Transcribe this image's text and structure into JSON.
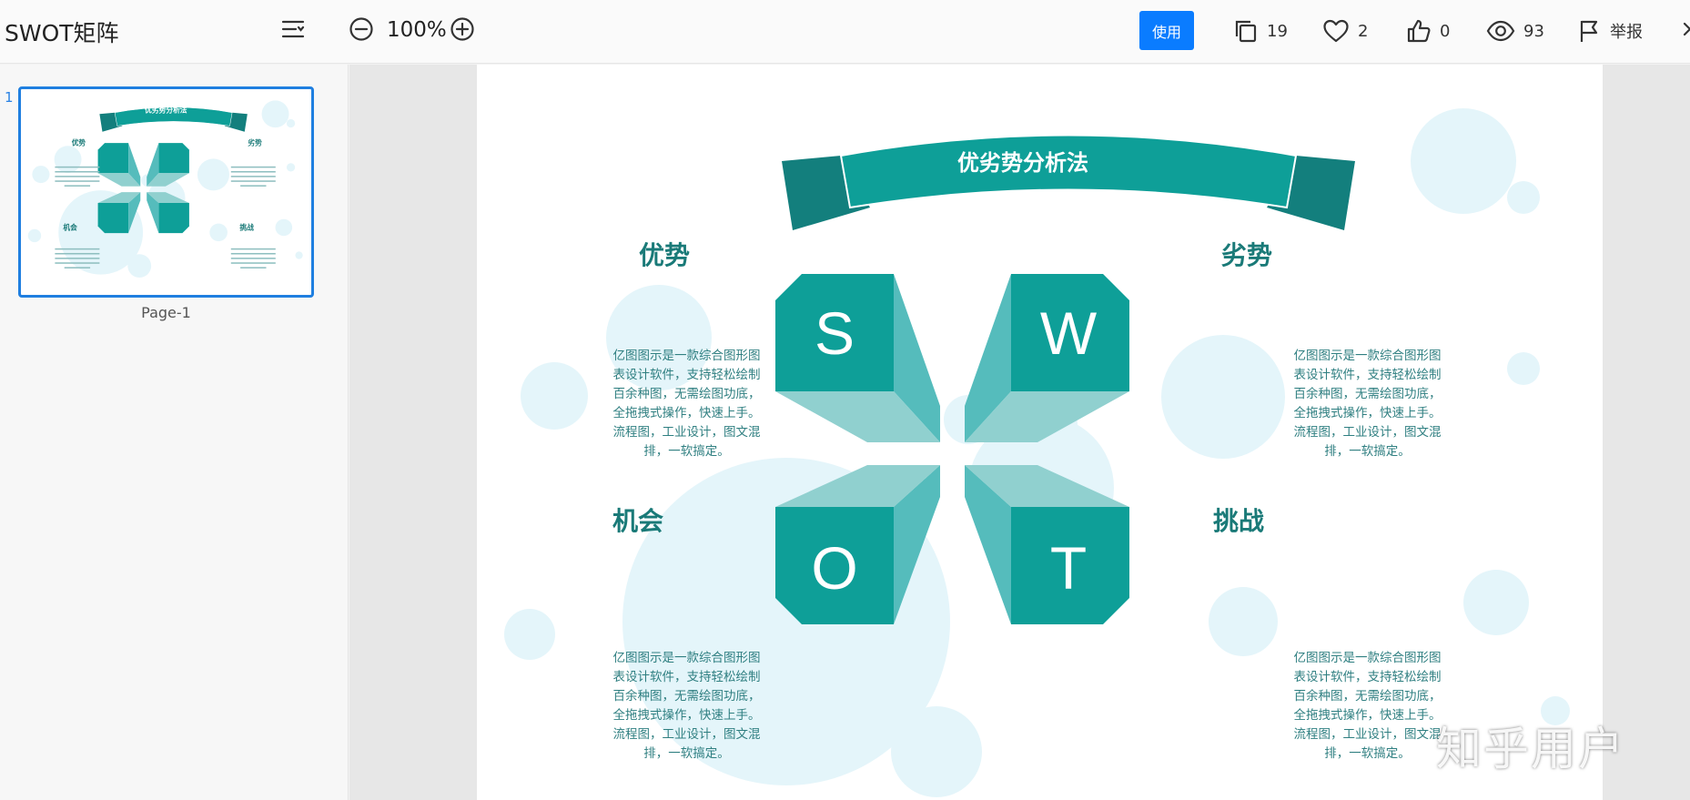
{
  "app": {
    "title": "SWOT矩阵"
  },
  "toolbar": {
    "zoom": "100%",
    "use_label": "使用",
    "stats": {
      "copies": "19",
      "favorites": "2",
      "likes": "0",
      "views": "93",
      "report": "举报"
    }
  },
  "sidebar": {
    "page_number": "1",
    "page_label": "Page-1"
  },
  "slide": {
    "banner_title": "优劣势分析法",
    "quadrants": [
      {
        "title": "优势",
        "letter": "S",
        "text": "亿图图示是一款综合图形图表设计软件，支持轻松绘制百余种图，无需绘图功底，全拖拽式操作，快速上手。流程图，工业设计，图文混排，一软搞定。"
      },
      {
        "title": "劣势",
        "letter": "W",
        "text": "亿图图示是一款综合图形图表设计软件，支持轻松绘制百余种图，无需绘图功底，全拖拽式操作，快速上手。流程图，工业设计，图文混排，一软搞定。"
      },
      {
        "title": "机会",
        "letter": "O",
        "text": "亿图图示是一款综合图形图表设计软件，支持轻松绘制百余种图，无需绘图功底，全拖拽式操作，快速上手。流程图，工业设计，图文混排，一软搞定。"
      },
      {
        "title": "挑战",
        "letter": "T",
        "text": "亿图图示是一款综合图形图表设计软件，支持轻松绘制百余种图，无需绘图功底，全拖拽式操作，快速上手。流程图，工业设计，图文混排，一软搞定。"
      }
    ]
  },
  "watermark": "知乎用户",
  "colors": {
    "teal": "#0e9f98",
    "teal_dark": "#137f7d",
    "teal_light": "#55bcbc",
    "teal_pale": "#90d0cf",
    "title_teal": "#1a7a78",
    "text": "#2f7f81",
    "bubble": "#e4f5fa",
    "accent_blue": "#0a7cff"
  }
}
